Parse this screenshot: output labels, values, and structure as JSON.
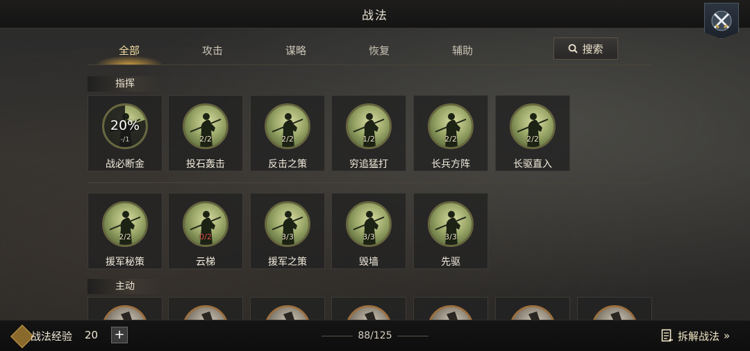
{
  "header": {
    "title": "战法",
    "close_icon": "crossed-swords-icon"
  },
  "tabs": [
    {
      "label": "全部",
      "active": true
    },
    {
      "label": "攻击",
      "active": false
    },
    {
      "label": "谋略",
      "active": false
    },
    {
      "label": "恢复",
      "active": false
    },
    {
      "label": "辅助",
      "active": false
    }
  ],
  "search": {
    "label": "搜索",
    "icon": "search-icon"
  },
  "sections": {
    "command": {
      "label": "指挥"
    },
    "active": {
      "label": "主动"
    }
  },
  "cards": [
    {
      "name": "战必断金",
      "count": "-/1",
      "progress": "20%"
    },
    {
      "name": "投石轰击",
      "count": "2/2"
    },
    {
      "name": "反击之策",
      "count": "2/2"
    },
    {
      "name": "穷追猛打",
      "count": "1/2"
    },
    {
      "name": "长兵方阵",
      "count": "2/2"
    },
    {
      "name": "长驱直入",
      "count": "2/2"
    },
    {
      "name": "援军秘策",
      "count": "2/2"
    },
    {
      "name": "云梯",
      "count": "0/2"
    },
    {
      "name": "援军之策",
      "count": "3/3"
    },
    {
      "name": "毁墙",
      "count": "3/3"
    },
    {
      "name": "先驱",
      "count": "3/3"
    }
  ],
  "footer": {
    "exp_label": "战法经验",
    "exp_value": "20",
    "exp_icon": "tactic-book-icon",
    "plus_label": "+",
    "page_counter": "88/125",
    "dismantle_label": "拆解战法",
    "dismantle_arrow": "»",
    "dismantle_icon": "document-list-icon"
  },
  "colors": {
    "accent": "#f4dfa2",
    "warning": "#e25a4a",
    "badge_green": "#9aa768"
  }
}
